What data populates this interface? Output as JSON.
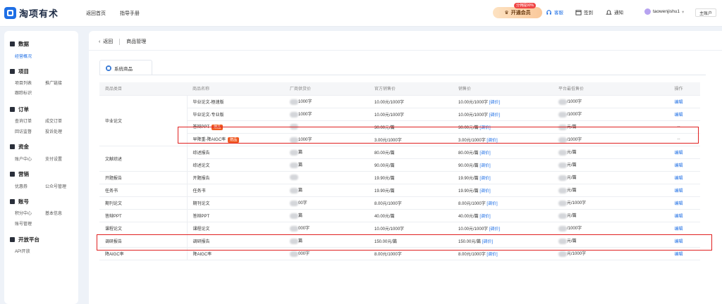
{
  "header": {
    "logo_text": "淘项有术",
    "nav": [
      "返回首页",
      "指导手册"
    ],
    "vip_label": "开通会员",
    "vip_badge": "分佣提90%",
    "customer_service": "客服",
    "sign_in": "签到",
    "notice": "通知",
    "username": "taowenjishu1",
    "switch_account": "主账户"
  },
  "sidebar": {
    "groups": [
      {
        "title": "数据",
        "links": [
          "经营概况"
        ]
      },
      {
        "title": "项目",
        "links": [
          "项目列表",
          "推广链接",
          "跟踪标识"
        ]
      },
      {
        "title": "订单",
        "links": [
          "查询订单",
          "成交订单",
          "回访监督",
          "投诉处理"
        ]
      },
      {
        "title": "资金",
        "links": [
          "账户中心",
          "支付设置"
        ]
      },
      {
        "title": "营销",
        "links": [
          "优惠券",
          "公众号管理"
        ]
      },
      {
        "title": "账号",
        "links": [
          "积分中心",
          "基本信息",
          "账号管理"
        ]
      },
      {
        "title": "开放平台",
        "links": [
          "API开放"
        ]
      }
    ]
  },
  "main": {
    "back": "返回",
    "breadcrumb": "商品管理",
    "tab": "系统商品",
    "columns": [
      "商品类目",
      "商品名称",
      "厂商供货价",
      "官方销售价",
      "销售价",
      "平台最低售价",
      "操作"
    ],
    "adjust_label": "[调价]",
    "edit_label": "编辑",
    "dash": "--",
    "badge_label": "赠品",
    "rows": [
      {
        "cat": "毕业论文",
        "name": "毕业论文-極速版",
        "supply": "1000字",
        "official": "10.00元/1000字",
        "sale": "10.00元/1000字",
        "min": "/1000字",
        "op": "编辑",
        "badge": false
      },
      {
        "cat": "",
        "name": "毕业论文-专业版",
        "supply": "1000字",
        "official": "10.00元/1000字",
        "sale": "10.00元/1000字",
        "min": "/1000字",
        "op": "编辑",
        "badge": false
      },
      {
        "cat": "",
        "name": "答辩PPT",
        "supply": "",
        "official": "30.00元/篇",
        "sale": "30.00元/篇",
        "min": "元/篇",
        "op": "--",
        "badge": true
      },
      {
        "cat": "",
        "name": "早降重-降AIGC率",
        "supply": "1000字",
        "official": "3.00元/1000字",
        "sale": "3.00元/1000字",
        "min": "/1000字",
        "op": "--",
        "badge": true
      },
      {
        "cat": "文献综述",
        "name": "综述报告",
        "supply": "篇",
        "official": "80.00元/篇",
        "sale": "80.00元/篇",
        "min": "元/篇",
        "op": "编辑",
        "badge": false
      },
      {
        "cat": "",
        "name": "综述论文",
        "supply": "篇",
        "official": "90.00元/篇",
        "sale": "90.00元/篇",
        "min": "元/篇",
        "op": "编辑",
        "badge": false
      },
      {
        "cat": "开题报告",
        "name": "开题报告",
        "supply": "",
        "official": "19.90元/篇",
        "sale": "19.90元/篇",
        "min": "元/篇",
        "op": "编辑",
        "badge": false
      },
      {
        "cat": "任务书",
        "name": "任务书",
        "supply": "篇",
        "official": "19.90元/篇",
        "sale": "19.90元/篇",
        "min": "元/篇",
        "op": "编辑",
        "badge": false
      },
      {
        "cat": "期刊论文",
        "name": "期刊论文",
        "supply": "00字",
        "official": "8.00元/1000字",
        "sale": "8.00元/1000字",
        "min": "元/1000字",
        "op": "编辑",
        "badge": false
      },
      {
        "cat": "答辩PPT",
        "name": "答辩PPT",
        "supply": "篇",
        "official": "40.00元/篇",
        "sale": "40.00元/篇",
        "min": "元/篇",
        "op": "编辑",
        "badge": false
      },
      {
        "cat": "课程论文",
        "name": "课程论文",
        "supply": "000字",
        "official": "10.00元/1000字",
        "sale": "10.00元/1000字",
        "min": "/1000字",
        "op": "编辑",
        "badge": false
      },
      {
        "cat": "调研报告",
        "name": "调研报告",
        "supply": "篇",
        "official": "150.00元/篇",
        "sale": "150.00元/篇",
        "min": "元/篇",
        "op": "编辑",
        "badge": false
      },
      {
        "cat": "降AIGC率",
        "name": "降AIGC率",
        "supply": "000字",
        "official": "8.00元/1000字",
        "sale": "8.00元/1000字",
        "min": "元/1000字",
        "op": "编辑",
        "badge": false
      }
    ]
  },
  "colors": {
    "accent": "#1f6fe5",
    "highlight": "#e02020",
    "badge": "#f05a23"
  }
}
